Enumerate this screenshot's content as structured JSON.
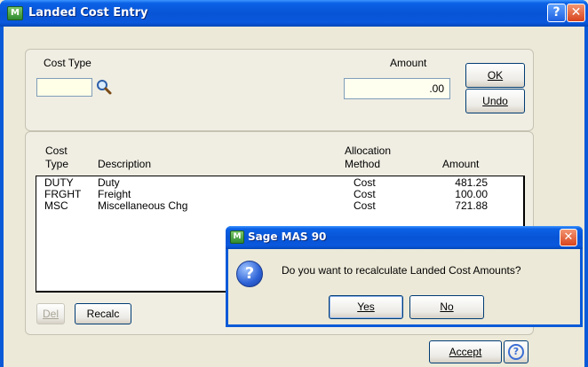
{
  "window": {
    "title": "Landed Cost Entry",
    "app_icon_text": "M",
    "help_glyph": "?",
    "close_glyph": "✕"
  },
  "top": {
    "cost_type_label": "Cost Type",
    "cost_type_value": "",
    "amount_label": "Amount",
    "amount_value": ".00",
    "ok_label": "OK",
    "undo_label": "Undo"
  },
  "grid": {
    "headers": {
      "cost_type_1": "Cost",
      "cost_type_2": "Type",
      "description": "Description",
      "allocation_1": "Allocation",
      "allocation_2": "Method",
      "amount": "Amount"
    },
    "rows": [
      {
        "cost_type": "DUTY",
        "description": "Duty",
        "method": "Cost",
        "amount": "481.25"
      },
      {
        "cost_type": "FRGHT",
        "description": "Freight",
        "method": "Cost",
        "amount": "100.00"
      },
      {
        "cost_type": "MSC",
        "description": "Miscellaneous Chg",
        "method": "Cost",
        "amount": "721.88"
      }
    ]
  },
  "buttons": {
    "del_label": "Del",
    "recalc_label": "Recalc",
    "accept_label": "Accept"
  },
  "dialog": {
    "title": "Sage MAS 90",
    "message": "Do you want to recalculate Landed Cost Amounts?",
    "yes_label": "Yes",
    "no_label": "No"
  },
  "icons": [
    "app-icon",
    "help-icon",
    "close-icon",
    "search-icon",
    "question-icon"
  ]
}
